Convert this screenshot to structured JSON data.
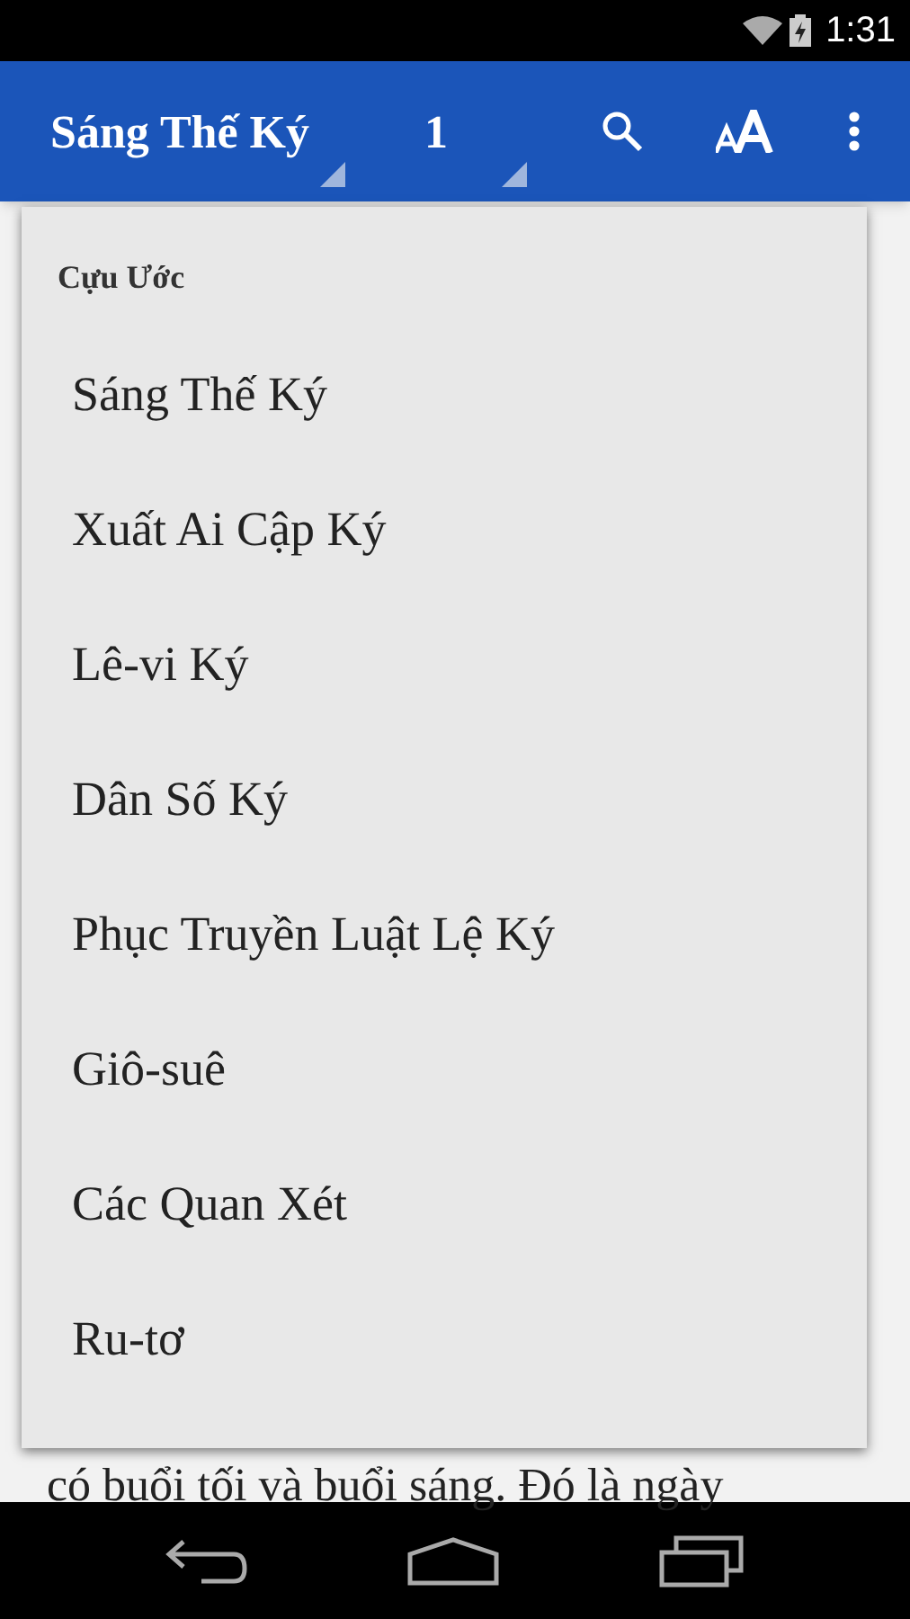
{
  "status_bar": {
    "time": "1:31"
  },
  "app_bar": {
    "book": "Sáng Thế Ký",
    "chapter": "1"
  },
  "content": {
    "visible_line": "có buổi tối và buổi sáng. Đó là ngày"
  },
  "dropdown": {
    "section": "Cựu Ước",
    "items": [
      {
        "label": "Sáng Thế Ký"
      },
      {
        "label": "Xuất Ai Cập Ký"
      },
      {
        "label": "Lê-vi Ký"
      },
      {
        "label": "Dân Số Ký"
      },
      {
        "label": "Phục Truyền Luật Lệ Ký"
      },
      {
        "label": "Giô-suê"
      },
      {
        "label": "Các Quan Xét"
      },
      {
        "label": "Ru-tơ"
      }
    ]
  }
}
